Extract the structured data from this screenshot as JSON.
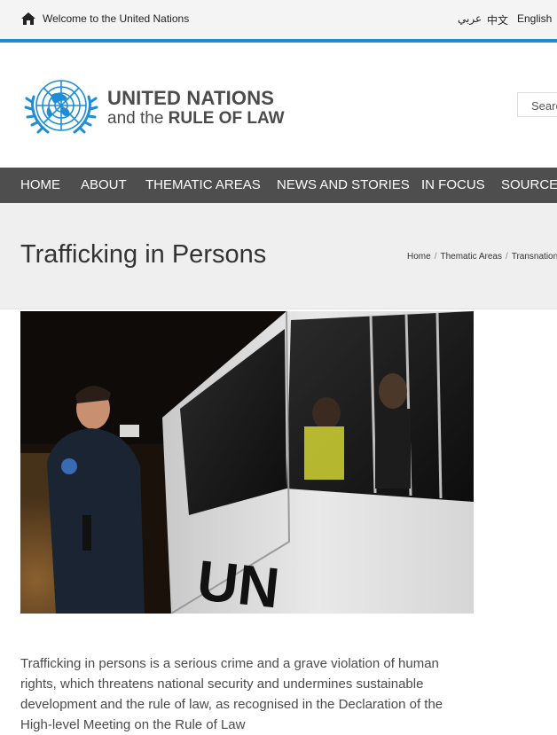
{
  "topbar": {
    "welcome": "Welcome to the United Nations",
    "languages": [
      "عربي",
      "中文",
      "English"
    ]
  },
  "header": {
    "brand_line1": "UNITED NATIONS",
    "brand_line2_small": "and the ",
    "brand_line2_big": "RULE OF LAW",
    "search_placeholder": "Search"
  },
  "nav": {
    "items": [
      "HOME",
      "ABOUT",
      "THEMATIC AREAS",
      "NEWS AND STORIES",
      "IN FOCUS",
      "SOURCES"
    ]
  },
  "page": {
    "title": "Trafficking in Persons",
    "breadcrumb": [
      "Home",
      "Thematic Areas",
      "Transnational"
    ]
  },
  "photo": {
    "van_lettering": "UN"
  },
  "content": {
    "intro": "Trafficking in persons is a serious crime and a grave violation of human rights, which threatens national security and undermines sustainable development and the rule of law, as recognised in the Declaration of the High-level Meeting on the Rule of Law"
  }
}
